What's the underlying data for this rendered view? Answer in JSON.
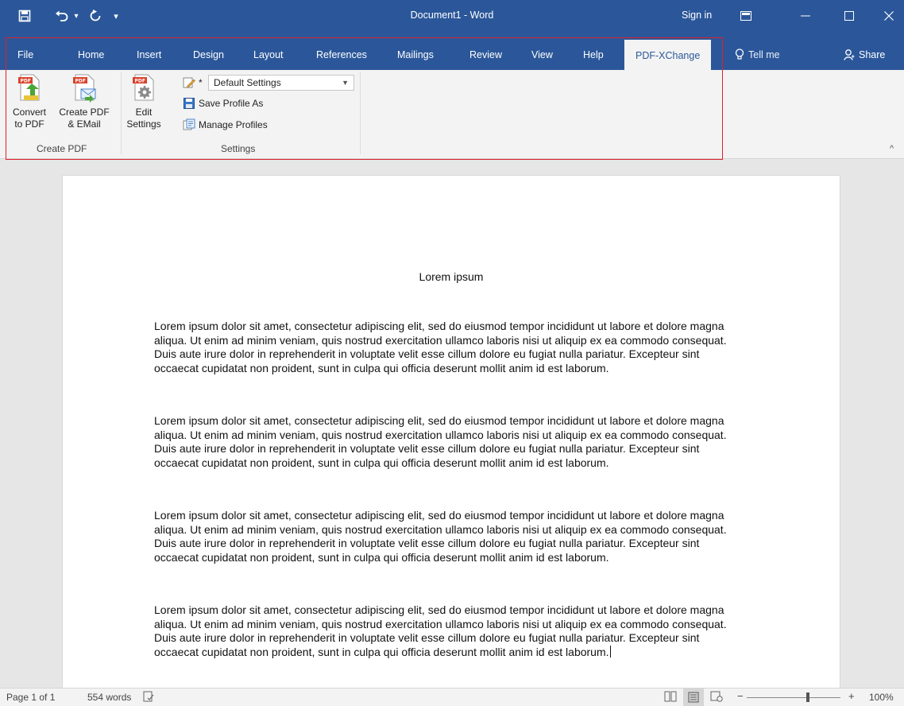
{
  "titlebar": {
    "title": "Document1  -  Word",
    "sign_in": "Sign in",
    "qa_save_icon": "save-icon",
    "qa_undo_icon": "undo-icon",
    "qa_redo_icon": "redo-icon",
    "qa_customize_icon": "customize-quick-access-icon"
  },
  "tabs": [
    {
      "label": "File"
    },
    {
      "label": "Home"
    },
    {
      "label": "Insert"
    },
    {
      "label": "Design"
    },
    {
      "label": "Layout"
    },
    {
      "label": "References"
    },
    {
      "label": "Mailings"
    },
    {
      "label": "Review"
    },
    {
      "label": "View"
    },
    {
      "label": "Help"
    },
    {
      "label": "PDF-XChange",
      "active": true
    }
  ],
  "tell_me": "Tell me",
  "share": "Share",
  "ribbon": {
    "create_pdf": {
      "convert_line1": "Convert",
      "convert_line2": "to PDF",
      "email_line1": "Create PDF",
      "email_line2": "& EMail",
      "group_label": "Create PDF"
    },
    "settings": {
      "edit_line1": "Edit",
      "edit_line2": "Settings",
      "profile_marker": "*",
      "profile_value": "Default Settings",
      "save_profile": "Save Profile As",
      "manage_profiles": "Manage Profiles",
      "group_label": "Settings"
    }
  },
  "document": {
    "heading": "Lorem ipsum",
    "paragraphs": [
      "Lorem ipsum dolor sit amet, consectetur adipiscing elit, sed do eiusmod tempor incididunt ut labore et dolore magna aliqua. Ut enim ad minim veniam, quis nostrud exercitation ullamco laboris nisi ut aliquip ex ea commodo consequat. Duis aute irure dolor in reprehenderit in voluptate velit esse cillum dolore eu fugiat nulla pariatur. Excepteur sint occaecat cupidatat non proident, sunt in culpa qui officia deserunt mollit anim id est laborum.",
      "Lorem ipsum dolor sit amet, consectetur adipiscing elit, sed do eiusmod tempor incididunt ut labore et dolore magna aliqua. Ut enim ad minim veniam, quis nostrud exercitation ullamco laboris nisi ut aliquip ex ea commodo consequat. Duis aute irure dolor in reprehenderit in voluptate velit esse cillum dolore eu fugiat nulla pariatur. Excepteur sint occaecat cupidatat non proident, sunt in culpa qui officia deserunt mollit anim id est laborum.",
      "Lorem ipsum dolor sit amet, consectetur adipiscing elit, sed do eiusmod tempor incididunt ut labore et dolore magna aliqua. Ut enim ad minim veniam, quis nostrud exercitation ullamco laboris nisi ut aliquip ex ea commodo consequat. Duis aute irure dolor in reprehenderit in voluptate velit esse cillum dolore eu fugiat nulla pariatur. Excepteur sint occaecat cupidatat non proident, sunt in culpa qui officia deserunt mollit anim id est laborum.",
      "Lorem ipsum dolor sit amet, consectetur adipiscing elit, sed do eiusmod tempor incididunt ut labore et dolore magna aliqua. Ut enim ad minim veniam, quis nostrud exercitation ullamco laboris nisi ut aliquip ex ea commodo consequat. Duis aute irure dolor in reprehenderit in voluptate velit esse cillum dolore eu fugiat nulla pariatur. Excepteur sint occaecat cupidatat non proident, sunt in culpa qui officia deserunt mollit anim id est laborum."
    ]
  },
  "statusbar": {
    "page": "Page 1 of 1",
    "words": "554 words",
    "zoom": "100%"
  },
  "colors": {
    "accent": "#2b579a",
    "highlight_box": "#e0202a"
  }
}
